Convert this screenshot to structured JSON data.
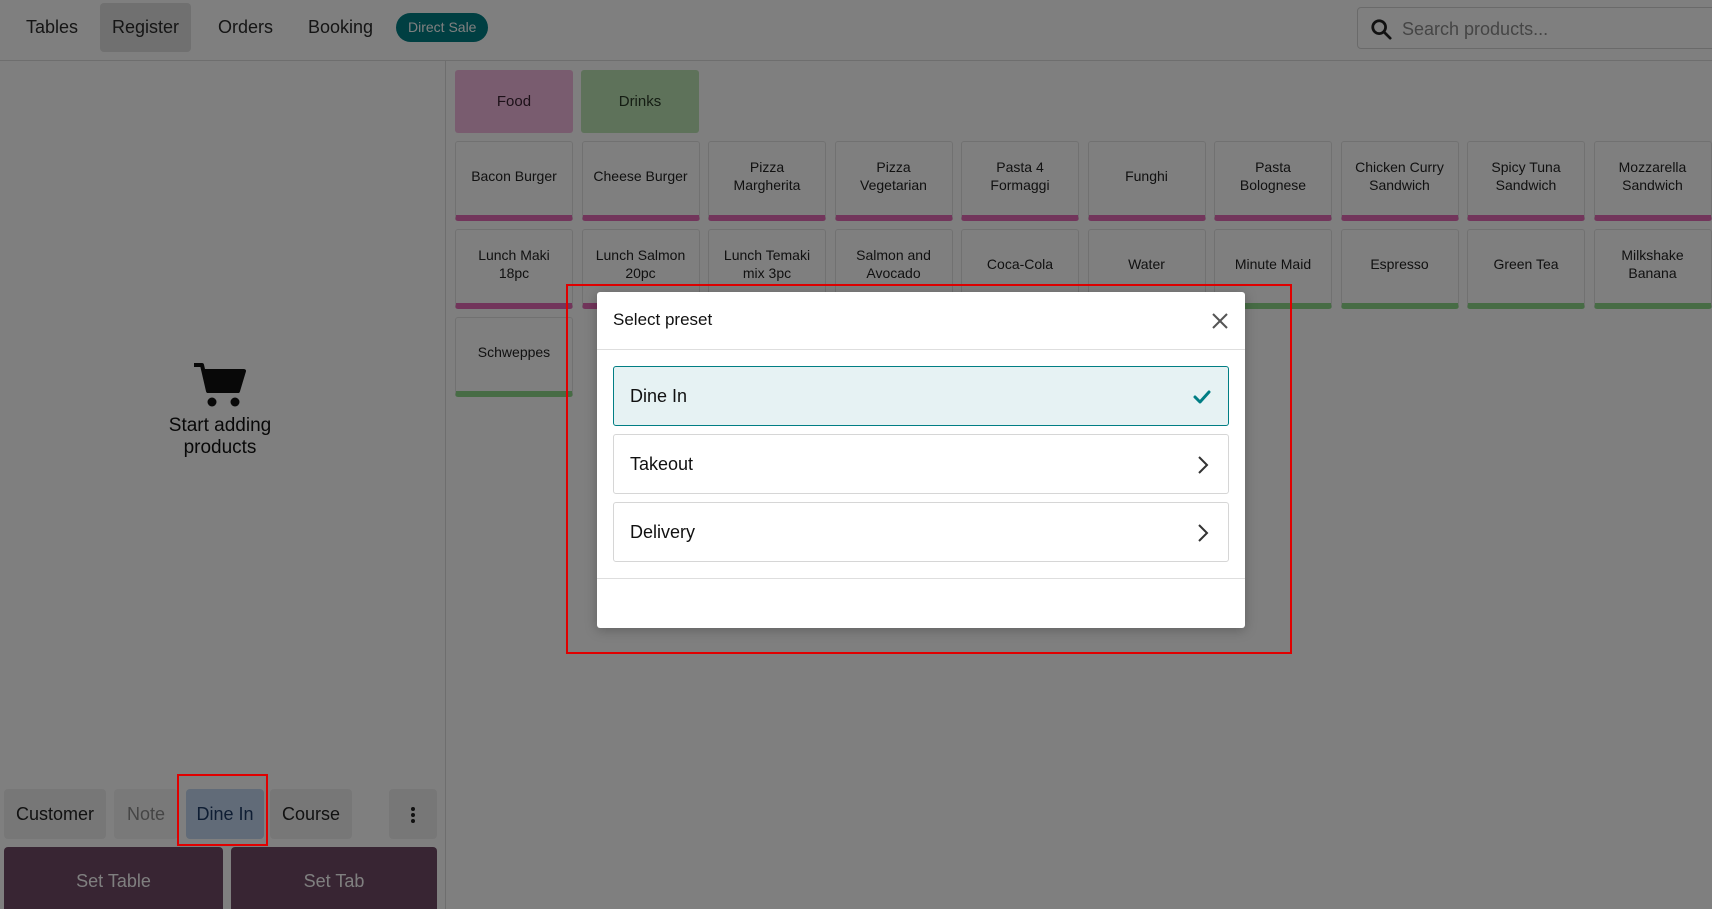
{
  "topbar": {
    "nav": [
      "Tables",
      "Register",
      "Orders",
      "Booking"
    ],
    "active_nav": "Register",
    "badge": "Direct Sale",
    "search_placeholder": "Search products..."
  },
  "order": {
    "empty_message_line1": "Start adding",
    "empty_message_line2": "products",
    "actions": {
      "customer": "Customer",
      "note": "Note",
      "preset": "Dine In",
      "course": "Course"
    },
    "set_table": "Set Table",
    "set_tab": "Set Tab"
  },
  "categories": [
    "Food",
    "Drinks"
  ],
  "products": [
    {
      "name": "Bacon Burger",
      "category": "food"
    },
    {
      "name": "Cheese Burger",
      "category": "food"
    },
    {
      "name": "Pizza Margherita",
      "category": "food"
    },
    {
      "name": "Pizza Vegetarian",
      "category": "food"
    },
    {
      "name": "Pasta 4 Formaggi",
      "category": "food"
    },
    {
      "name": "Funghi",
      "category": "food"
    },
    {
      "name": "Pasta Bolognese",
      "category": "food"
    },
    {
      "name": "Chicken Curry Sandwich",
      "category": "food"
    },
    {
      "name": "Spicy Tuna Sandwich",
      "category": "food"
    },
    {
      "name": "Mozzarella Sandwich",
      "category": "food"
    },
    {
      "name": "Lunch Maki 18pc",
      "category": "food"
    },
    {
      "name": "Lunch Salmon 20pc",
      "category": "food"
    },
    {
      "name": "Lunch Temaki mix 3pc",
      "category": "food"
    },
    {
      "name": "Salmon and Avocado",
      "category": "food"
    },
    {
      "name": "Coca-Cola",
      "category": "drink"
    },
    {
      "name": "Water",
      "category": "drink"
    },
    {
      "name": "Minute Maid",
      "category": "drink"
    },
    {
      "name": "Espresso",
      "category": "drink"
    },
    {
      "name": "Green Tea",
      "category": "drink"
    },
    {
      "name": "Milkshake Banana",
      "category": "drink"
    },
    {
      "name": "Schweppes",
      "category": "drink"
    }
  ],
  "dialog": {
    "title": "Select preset",
    "options": [
      {
        "label": "Dine In",
        "selected": true,
        "icon": "check-icon"
      },
      {
        "label": "Takeout",
        "selected": false,
        "icon": "chevron-right-icon"
      },
      {
        "label": "Delivery",
        "selected": false,
        "icon": "chevron-right-icon"
      }
    ]
  },
  "colors": {
    "brand_teal": "#017e84",
    "primary_purple": "#714b67",
    "food_accent": "#e46bb7",
    "drink_accent": "#8fd88a",
    "highlight_red": "#e00000"
  }
}
